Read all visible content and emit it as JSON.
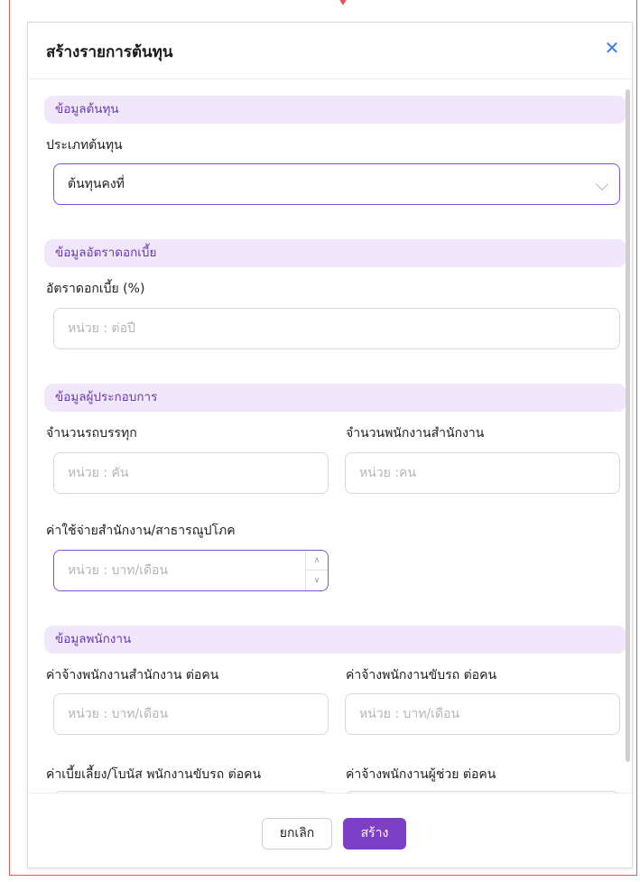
{
  "modal": {
    "title": "สร้างรายการต้นทุน",
    "close_icon": "close-icon"
  },
  "sections": {
    "cost_info": {
      "heading": "ข้อมูลต้นทุน",
      "cost_type_label": "ประเภทต้นทุน",
      "cost_type_value": "ต้นทุนคงที่"
    },
    "interest_info": {
      "heading": "ข้อมูลอัตราดอกเบี้ย",
      "rate_label": "อัตราดอกเบี้ย (%)",
      "rate_placeholder": "หน่วย : ต่อปี"
    },
    "operator_info": {
      "heading": "ข้อมูลผู้ประกอบการ",
      "trucks_label": "จำนวนรถบรรทุก",
      "trucks_placeholder": "หน่วย : คัน",
      "office_staff_label": "จำนวนพนักงานสำนักงาน",
      "office_staff_placeholder": "หน่วย :คน",
      "office_expense_label": "ค่าใช้จ่ายสำนักงาน/สาธารณูปโภค",
      "office_expense_placeholder": "หน่วย : บาท/เดือน"
    },
    "employee_info": {
      "heading": "ข้อมูลพนักงาน",
      "office_wage_label": "ค่าจ้างพนักงานสำนักงาน ต่อคน",
      "office_wage_placeholder": "หน่วย : บาท/เดือน",
      "driver_wage_label": "ค่าจ้างพนักงานขับรถ ต่อคน",
      "driver_wage_placeholder": "หน่วย : บาท/เดือน",
      "driver_allowance_label": "ค่าเบี้ยเลี้ยง/โบนัส พนักงานขับรถ ต่อคน",
      "assistant_wage_label": "ค่าจ้างพนักงานผู้ช่วย ต่อคน"
    }
  },
  "footer": {
    "cancel_label": "ยกเลิก",
    "create_label": "สร้าง"
  },
  "colors": {
    "accent": "#7e3fc7",
    "section_bg": "#f0e8fa",
    "section_text": "#6a38b8",
    "close": "#3b7ce8",
    "frame": "#e05a5a"
  }
}
